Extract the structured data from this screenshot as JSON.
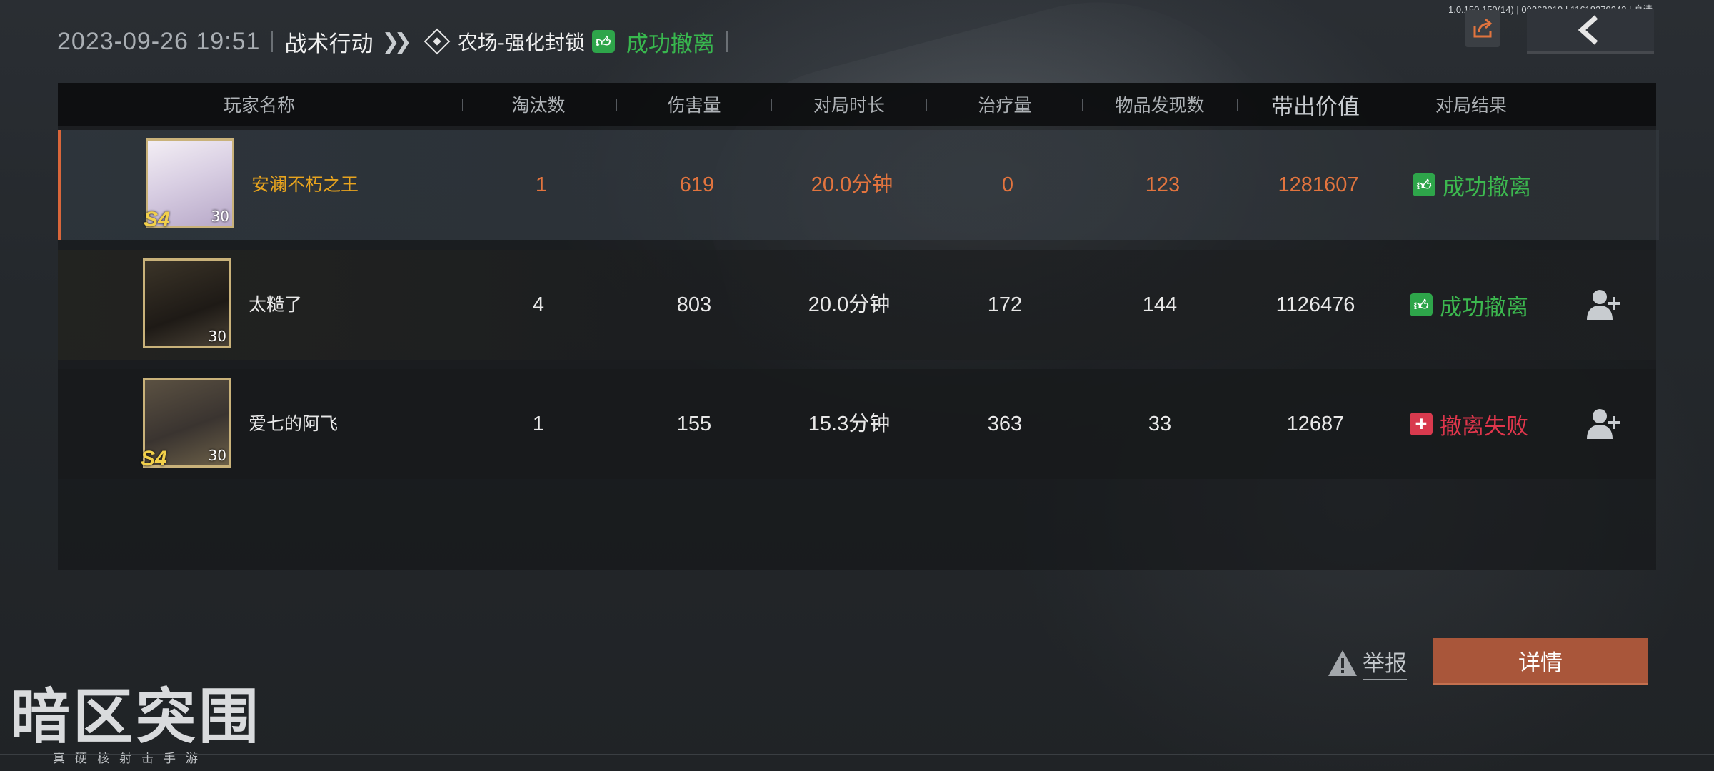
{
  "version_text": "1.0.150.150(14) | 09262019 | 11618379343 | 高清",
  "header": {
    "datetime": "2023-09-26 19:51",
    "mode": "战术行动",
    "map": "农场-强化封锁",
    "result": "成功撤离"
  },
  "table": {
    "columns": [
      "玩家名称",
      "淘汰数",
      "伤害量",
      "对局时长",
      "治疗量",
      "物品发现数",
      "带出价值",
      "对局结果"
    ],
    "rows": [
      {
        "name": "安澜不朽之王",
        "season": "S4",
        "level": "30",
        "eliminations": "1",
        "damage": "619",
        "duration": "20.0分钟",
        "healing": "0",
        "items_found": "123",
        "value": "1281607",
        "result": "成功撤离"
      },
      {
        "name": "太糙了",
        "season": "",
        "level": "30",
        "eliminations": "4",
        "damage": "803",
        "duration": "20.0分钟",
        "healing": "172",
        "items_found": "144",
        "value": "1126476",
        "result": "成功撤离"
      },
      {
        "name": "爱七的阿飞",
        "season": "S4",
        "level": "30",
        "eliminations": "1",
        "damage": "155",
        "duration": "15.3分钟",
        "healing": "363",
        "items_found": "33",
        "value": "12687",
        "result": "撤离失败"
      }
    ]
  },
  "actions": {
    "report": "举报",
    "details": "详情"
  },
  "logo": {
    "title": "暗区突围",
    "subtitle": "真硬核射击手游"
  },
  "colors": {
    "success": "#3cb84f",
    "fail": "#e0364c",
    "self_highlight": "#e2743e",
    "details_button": "#a9563a"
  }
}
